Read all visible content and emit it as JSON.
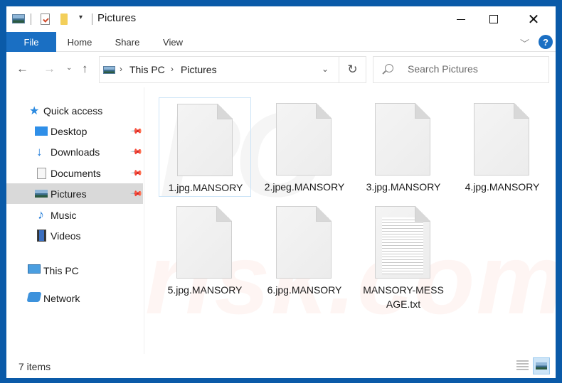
{
  "window": {
    "title": "Pictures",
    "controls": {
      "minimize": "minimize",
      "maximize": "maximize",
      "close": "✕"
    }
  },
  "quick_access_toolbar": {
    "icons": [
      "pictures-folder-icon",
      "properties-icon",
      "new-folder-icon",
      "customize-dropdown-icon"
    ],
    "dropdown_glyph": "▾"
  },
  "ribbon": {
    "tabs": [
      {
        "label": "File",
        "active": true
      },
      {
        "label": "Home"
      },
      {
        "label": "Share"
      },
      {
        "label": "View"
      }
    ],
    "expand_glyph": "﹀",
    "help_glyph": "?"
  },
  "navigation": {
    "back_glyph": "←",
    "forward_glyph": "→",
    "recent_glyph": "⌄",
    "up_glyph": "↑",
    "breadcrumb": [
      "This PC",
      "Pictures"
    ],
    "separator_glyph": "›",
    "dropdown_glyph": "⌄",
    "refresh_glyph": "↻",
    "search_placeholder": "Search Pictures"
  },
  "sidebar": {
    "items": [
      {
        "label": "Quick access",
        "icon": "star-icon",
        "glyph": "★"
      },
      {
        "label": "Desktop",
        "icon": "desktop-icon",
        "pinned": true
      },
      {
        "label": "Downloads",
        "icon": "download-icon",
        "glyph": "🡇",
        "pinned": true
      },
      {
        "label": "Documents",
        "icon": "documents-icon",
        "pinned": true
      },
      {
        "label": "Pictures",
        "icon": "pictures-icon",
        "pinned": true,
        "selected": true
      },
      {
        "label": "Music",
        "icon": "music-icon",
        "glyph": "♪"
      },
      {
        "label": "Videos",
        "icon": "videos-icon"
      },
      {
        "label": "This PC",
        "icon": "this-pc-icon"
      },
      {
        "label": "Network",
        "icon": "network-icon"
      }
    ],
    "pin_glyph": "📌"
  },
  "files": [
    {
      "name": "1.jpg.MANSORY",
      "type": "generic"
    },
    {
      "name": "2.jpeg.MANSORY",
      "type": "generic"
    },
    {
      "name": "3.jpg.MANSORY",
      "type": "generic"
    },
    {
      "name": "4.jpg.MANSORY",
      "type": "generic"
    },
    {
      "name": "5.jpg.MANSORY",
      "type": "generic"
    },
    {
      "name": "6.jpg.MANSORY",
      "type": "generic"
    },
    {
      "name": "MANSORY-MESSAGE.txt",
      "display_name_lines": [
        "MANSORY-MESS",
        "AGE.txt"
      ],
      "type": "text"
    }
  ],
  "status": {
    "item_count": "7 items"
  },
  "watermark": {
    "line1": "PC",
    "line2": "risk.com"
  }
}
